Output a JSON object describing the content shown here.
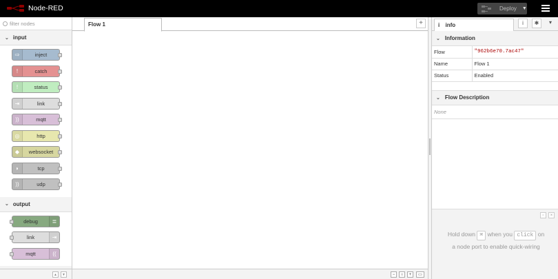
{
  "header": {
    "title": "Node-RED",
    "deploy_label": "Deploy"
  },
  "palette": {
    "filter_placeholder": "filter nodes",
    "categories": [
      {
        "label": "input",
        "nodes": [
          {
            "label": "inject",
            "color": "#a6bbcf"
          },
          {
            "label": "catch",
            "color": "#e49191"
          },
          {
            "label": "status",
            "color": "#c0edc0"
          },
          {
            "label": "link",
            "color": "#dddddd"
          },
          {
            "label": "mqtt",
            "color": "#d8bfd8"
          },
          {
            "label": "http",
            "color": "#e7e7ae"
          },
          {
            "label": "websocket",
            "color": "#d7d7a0"
          },
          {
            "label": "tcp",
            "color": "#c0c0c0"
          },
          {
            "label": "udp",
            "color": "#c0c0c0"
          }
        ]
      },
      {
        "label": "output",
        "nodes": [
          {
            "label": "debug",
            "color": "#87a980"
          },
          {
            "label": "link",
            "color": "#dddddd"
          },
          {
            "label": "mqtt",
            "color": "#d8bfd8"
          }
        ]
      }
    ]
  },
  "workspace": {
    "tabs": [
      {
        "label": "Flow 1"
      }
    ],
    "add_tab_label": "+"
  },
  "sidebar": {
    "tab_label": "info",
    "information": {
      "title": "Information",
      "rows": [
        {
          "key": "Flow",
          "value": "\"962b6e70.7ac47\""
        },
        {
          "key": "Name",
          "value": "Flow 1"
        },
        {
          "key": "Status",
          "value": "Enabled"
        }
      ]
    },
    "flow_description": {
      "title": "Flow Description",
      "value": "None"
    },
    "tip": {
      "part1": "Hold down",
      "key1": "⌘",
      "part2": "when you",
      "key2": "click",
      "part3": "on",
      "part4": "a node port to enable quick-wiring"
    }
  }
}
